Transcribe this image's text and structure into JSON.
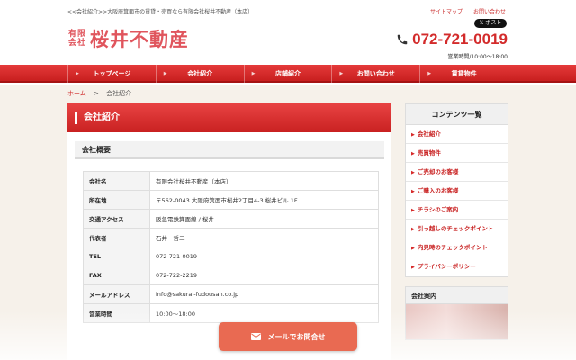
{
  "header": {
    "tagline": "<<会社紹介>>大阪府箕面市の賃貸・売買なら有限会社桜井不動産（本店）",
    "links": [
      "サイトマップ",
      "お問い合わせ"
    ],
    "post_label": "ポスト",
    "logo_small_top": "有限",
    "logo_small_bottom": "会社",
    "logo_main": "桜井不動産",
    "tel": "072-721-0019",
    "hours": "営業時間/10:00～18:00"
  },
  "nav": {
    "items": [
      "トップページ",
      "会社紹介",
      "店舗紹介",
      "お問い合わせ",
      "賃貸物件"
    ]
  },
  "breadcrumb": {
    "home": "ホーム",
    "sep": ">",
    "current": "会社紹介"
  },
  "main": {
    "title": "会社紹介",
    "section_title": "会社概要",
    "rows": [
      {
        "key": "会社名",
        "value": "有限会社桜井不動産（本店）"
      },
      {
        "key": "所在地",
        "value": "〒562-0043 大阪府箕面市桜井2丁目4-3 桜井ビル 1F"
      },
      {
        "key": "交通アクセス",
        "value": "阪急電鉄箕面線 / 桜井"
      },
      {
        "key": "代表者",
        "value": "石井　哲二"
      },
      {
        "key": "TEL",
        "value": "072-721-0019"
      },
      {
        "key": "FAX",
        "value": "072-722-2219"
      },
      {
        "key": "メールアドレス",
        "value": "info@sakurai-fudousan.co.jp"
      },
      {
        "key": "営業時間",
        "value": "10:00～18:00"
      }
    ]
  },
  "sidebar": {
    "title": "コンテンツ一覧",
    "items": [
      "会社紹介",
      "売買物件",
      "ご売却のお客様",
      "ご購入のお客様",
      "チラシのご案内",
      "引っ越しのチェックポイント",
      "内見時のチェックポイント",
      "プライバシーポリシー"
    ],
    "company_title": "会社案内"
  },
  "cta": {
    "label": "メールでお問合せ"
  }
}
